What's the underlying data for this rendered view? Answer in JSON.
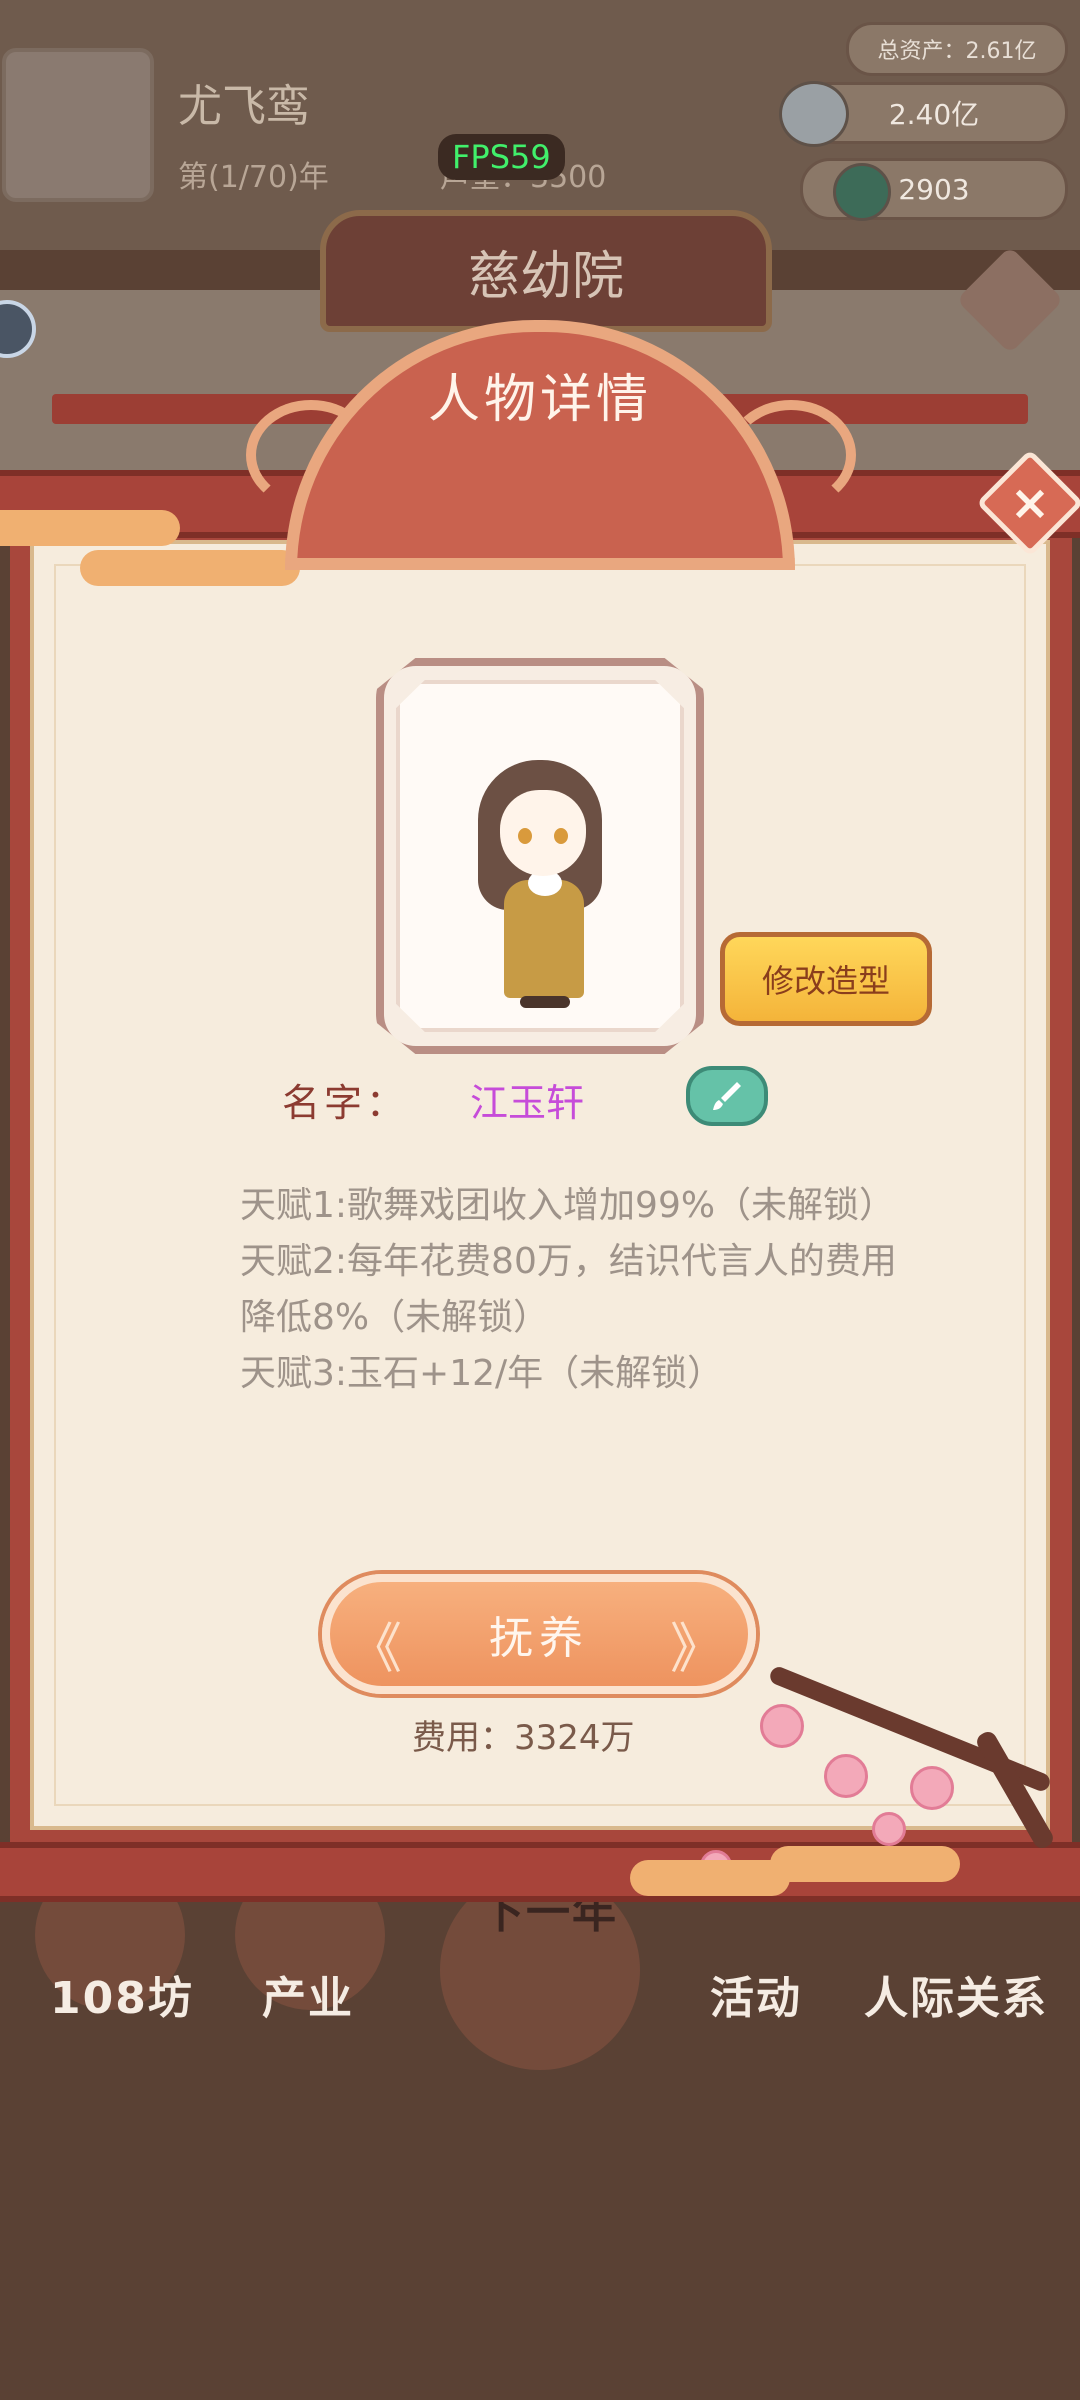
{
  "background": {
    "player_name": "尤飞鸾",
    "year_progress": "第(1/70)年",
    "fame": "声望：3500",
    "scene_title": "慈幼院",
    "fps": "FPS59",
    "resources": {
      "total_assets": "总资产：2.61亿",
      "silver": "2.40亿",
      "jade": "2903"
    },
    "bottom_nav": {
      "item1": "108坊",
      "item2": "产业",
      "center": "下一年",
      "item3": "活动",
      "item4": "人际关系"
    }
  },
  "modal": {
    "title": "人物详情",
    "restyle_button": "修改造型",
    "name_label": "名字：",
    "name_value": "江玉轩",
    "talents": [
      "天赋1:歌舞戏团收入增加99%（未解锁）",
      "天赋2:每年花费80万，结识代言人的费用降低8%（未解锁）",
      "天赋3:玉石+12/年（未解锁）"
    ],
    "adopt_button": "抚养",
    "adopt_arrow_left": "《",
    "adopt_arrow_right": "》",
    "cost": "费用：3324万",
    "close_icon": "×",
    "colors": {
      "name_value": "#c64cd9",
      "name_label": "#8c3b31",
      "adopt_button": "#ee935f",
      "restyle_button": "#f4b43a",
      "frame": "#a8473c"
    }
  }
}
